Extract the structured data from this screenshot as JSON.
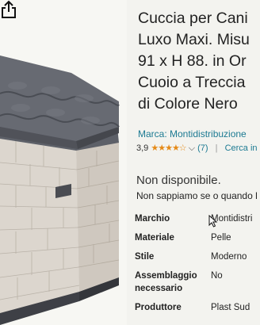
{
  "product": {
    "title_lines": [
      "Cuccia per Cani",
      "Luxo Maxi. Misu",
      "91 x H 88. in Or",
      "Cuoio a Treccia",
      "di Colore Nero"
    ],
    "brand_text": "Marca: Montidistribuzione",
    "rating": "3,9",
    "stars": "★★★★☆",
    "rating_count": "(7)",
    "separator": "|",
    "search_link": "Cerca in"
  },
  "availability": {
    "status": "Non disponibile.",
    "subtext": "Non sappiamo se o quando l"
  },
  "specs": [
    {
      "key": "Marchio",
      "value": "Montidistri"
    },
    {
      "key": "Materiale",
      "value": "Pelle"
    },
    {
      "key": "Stile",
      "value": "Moderno"
    },
    {
      "key": "Assemblaggio necessario",
      "value": "No"
    },
    {
      "key": "Produttore",
      "value": "Plast Sud"
    }
  ],
  "icons": {
    "share": "share-icon",
    "chevron": "chevron-down-icon",
    "cursor": "mouse-cursor-icon"
  },
  "colors": {
    "link": "#1c7a92",
    "star": "#e58a17",
    "roof": "#5b5e66",
    "wall": "#d9d3cb"
  }
}
